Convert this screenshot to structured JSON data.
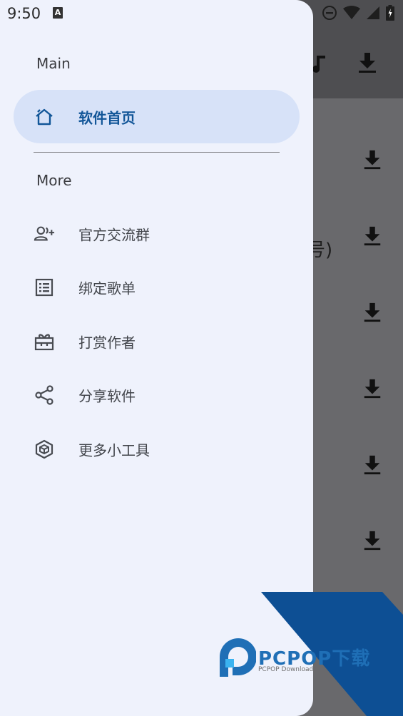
{
  "status_bar": {
    "time": "9:50",
    "notification_badge": "A"
  },
  "background": {
    "partial_text": "号)"
  },
  "drawer": {
    "section_main": "Main",
    "section_more": "More",
    "items": [
      {
        "label": "软件首页",
        "icon": "home-icon",
        "active": true
      },
      {
        "label": "官方交流群",
        "icon": "group-add-icon",
        "active": false
      },
      {
        "label": "绑定歌单",
        "icon": "list-icon",
        "active": false
      },
      {
        "label": "打赏作者",
        "icon": "gift-icon",
        "active": false
      },
      {
        "label": "分享软件",
        "icon": "share-icon",
        "active": false
      },
      {
        "label": "更多小工具",
        "icon": "box-icon",
        "active": false
      }
    ]
  },
  "watermark": {
    "brand": "PCPOP下载",
    "sub": "PCPOP Download"
  },
  "colors": {
    "drawer_bg": "#eff2fc",
    "active_bg": "#d7e2f8",
    "active_text": "#125698",
    "watermark_blue": "#0d4f94"
  }
}
